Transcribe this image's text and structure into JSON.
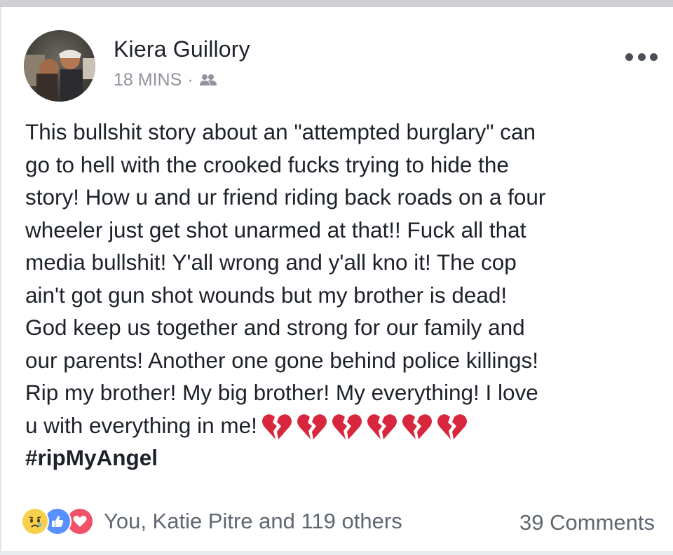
{
  "post": {
    "author_name": "Kiera Guillory",
    "timestamp": "18 MINS",
    "separator": "·",
    "audience_icon": "friends-icon",
    "more_icon": "more-options-icon",
    "body_lines": [
      "This bullshit story about an \"attempted burglary\" can",
      "go to hell with the crooked fucks trying to hide the",
      "story! How u and ur friend riding back roads on a four",
      "wheeler just get shot unarmed at that!! Fuck all that",
      "media bullshit! Y'all wrong and y'all kno it! The cop",
      "ain't got gun shot wounds but my brother is dead!",
      "God keep us together and strong for our family and",
      "our parents! Another one gone behind police killings!",
      "Rip my brother! My big brother! My everything! I love",
      "u with everything in me!"
    ],
    "emoji": [
      "broken-heart",
      "broken-heart",
      "broken-heart",
      "broken-heart",
      "broken-heart",
      "broken-heart"
    ],
    "hashtag": "#ripMyAngel"
  },
  "footer": {
    "reactions": [
      "sad-reaction-icon",
      "like-reaction-icon",
      "love-reaction-icon"
    ],
    "reaction_summary": "You, Katie Pitre and 119 others",
    "comments_count": "39 Comments"
  },
  "colors": {
    "text": "#1d2129",
    "secondary": "#90949c",
    "like_blue": "#5890ff",
    "love_red": "#f25268",
    "heart_red": "#d7263d"
  }
}
